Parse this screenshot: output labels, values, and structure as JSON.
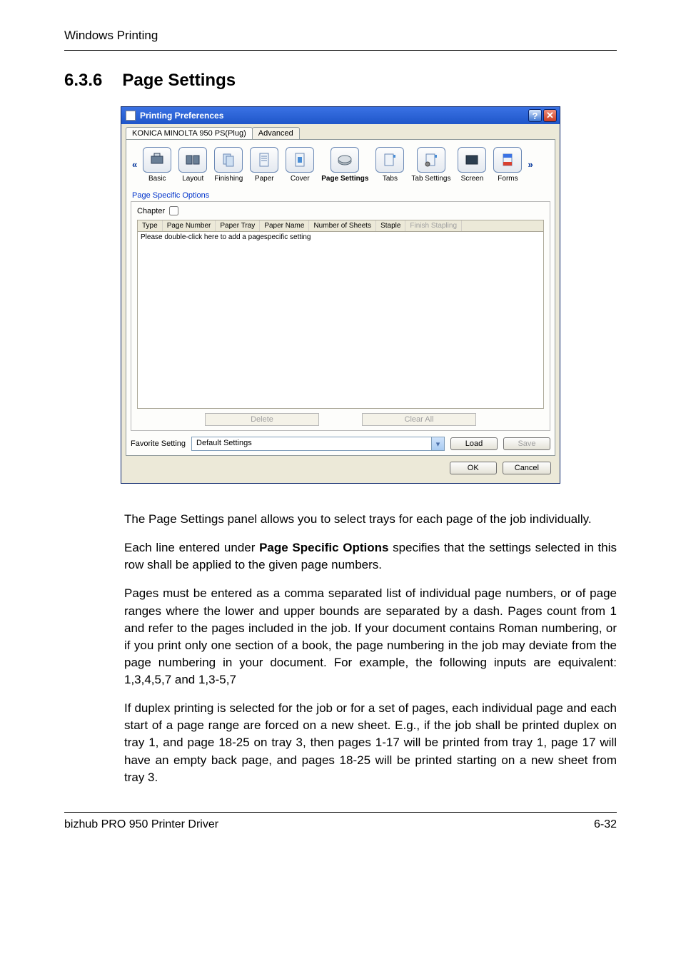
{
  "doc": {
    "header": "Windows Printing",
    "section_number": "6.3.6",
    "section_title": "Page Settings",
    "footer_left": "bizhub PRO 950 Printer Driver",
    "footer_right": "6-32"
  },
  "dialog": {
    "title": "Printing Preferences",
    "help_glyph": "?",
    "close_glyph": "✕",
    "outer_tabs": {
      "main": "KONICA MINOLTA 950 PS(Plug)",
      "advanced": "Advanced"
    },
    "chev_left": "«",
    "chev_right": "»",
    "toolbar": [
      {
        "label": "Basic",
        "icon": "basic"
      },
      {
        "label": "Layout",
        "icon": "layout"
      },
      {
        "label": "Finishing",
        "icon": "finishing"
      },
      {
        "label": "Paper",
        "icon": "paper"
      },
      {
        "label": "Cover",
        "icon": "cover"
      },
      {
        "label": "Page Settings",
        "icon": "pagesettings"
      },
      {
        "label": "Tabs",
        "icon": "tabs"
      },
      {
        "label": "Tab Settings",
        "icon": "tabsettings"
      },
      {
        "label": "Screen",
        "icon": "screen"
      },
      {
        "label": "Forms",
        "icon": "forms"
      }
    ],
    "section_label": "Page Specific Options",
    "chapter_label": "Chapter",
    "grid_headers": [
      {
        "label": "Type",
        "disabled": false
      },
      {
        "label": "Page Number",
        "disabled": false
      },
      {
        "label": "Paper Tray",
        "disabled": false
      },
      {
        "label": "Paper Name",
        "disabled": false
      },
      {
        "label": "Number of Sheets",
        "disabled": false
      },
      {
        "label": "Staple",
        "disabled": false
      },
      {
        "label": "Finish Stapling",
        "disabled": true
      }
    ],
    "grid_hint": "Please double-click here to add a pagespecific setting",
    "delete_btn": "Delete",
    "clear_all_btn": "Clear All",
    "favorite_label": "Favorite Setting",
    "favorite_value": "Default Settings",
    "load_btn": "Load",
    "save_btn": "Save",
    "ok_btn": "OK",
    "cancel_btn": "Cancel"
  },
  "paras": {
    "p1": "The Page Settings panel allows you to select trays for each page of the job individually.",
    "p2a": "Each line entered under ",
    "p2b": "Page Specific Options",
    "p2c": " specifies that the settings selected in this row shall be applied to the given page numbers.",
    "p3": "Pages must be entered as a comma separated list of individual page numbers, or of page ranges where the lower and upper bounds are separated by a dash. Pages count from 1 and refer to the pages included in the job. If your document contains Roman numbering, or if you print only one section of a book, the page numbering in the job may deviate from the page numbering in your document. For example, the following inputs are equivalent: 1,3,4,5,7 and 1,3-5,7",
    "p4": "If duplex printing is selected for the job or for a set of pages, each individual page and each start of a page range are forced on a new sheet. E.g., if the job shall be printed duplex on tray 1, and page 18-25 on tray 3, then pages 1-17 will be printed from tray 1, page 17 will have an empty back page, and pages 18-25 will be printed starting on a new sheet from tray 3."
  }
}
